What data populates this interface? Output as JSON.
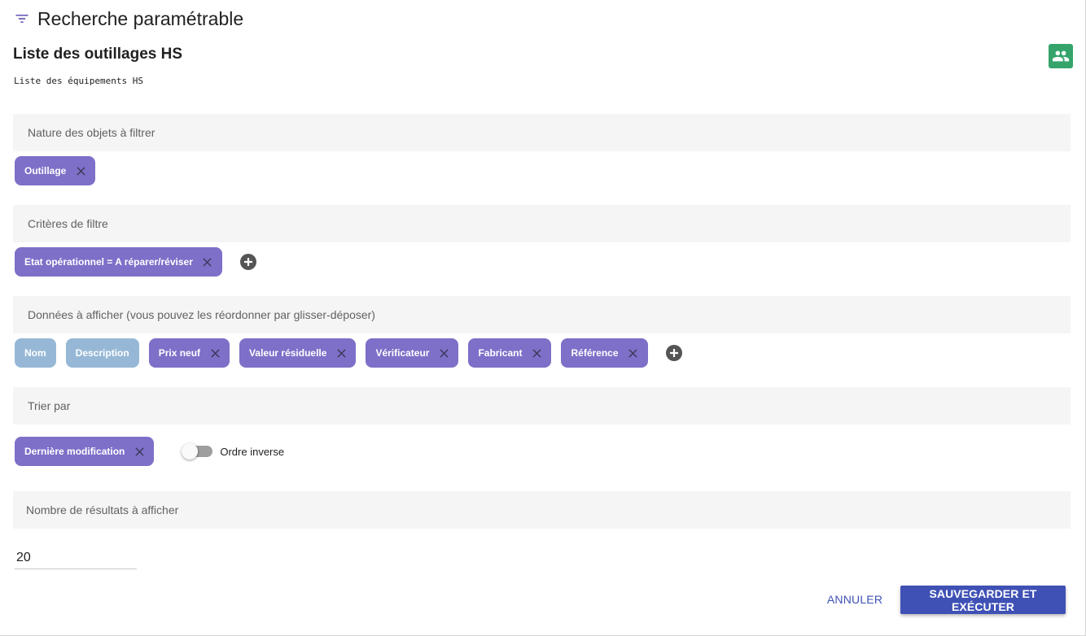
{
  "header": {
    "title": "Recherche paramétrable",
    "icon": "filter-list-icon"
  },
  "list": {
    "title": "Liste des outillages HS",
    "description": "Liste des équipements HS",
    "share_icon": "group-icon"
  },
  "sections": {
    "nature": {
      "label": "Nature des objets à filtrer",
      "chips": [
        "Outillage"
      ]
    },
    "criteria": {
      "label": "Critères de filtre",
      "chips": [
        "Etat opérationnel = A réparer/réviser"
      ]
    },
    "display": {
      "label": "Données à afficher (vous pouvez les réordonner par glisser-déposer)",
      "fixed_chips": [
        "Nom",
        "Description"
      ],
      "chips": [
        "Prix neuf",
        "Valeur résiduelle",
        "Vérificateur",
        "Fabricant",
        "Référence"
      ]
    },
    "sort": {
      "label": "Trier par",
      "chips": [
        "Dernière modification"
      ],
      "toggle_label": "Ordre inverse",
      "toggle_on": false
    },
    "results": {
      "label": "Nombre de résultats à afficher",
      "value": "20"
    }
  },
  "actions": {
    "cancel": "ANNULER",
    "submit": "SAUVEGARDER ET EXÉCUTER"
  },
  "colors": {
    "chip": "#7e6fc8",
    "chip_fixed": "#96b8d6",
    "primary": "#3f51b5",
    "share": "#34a46a"
  }
}
